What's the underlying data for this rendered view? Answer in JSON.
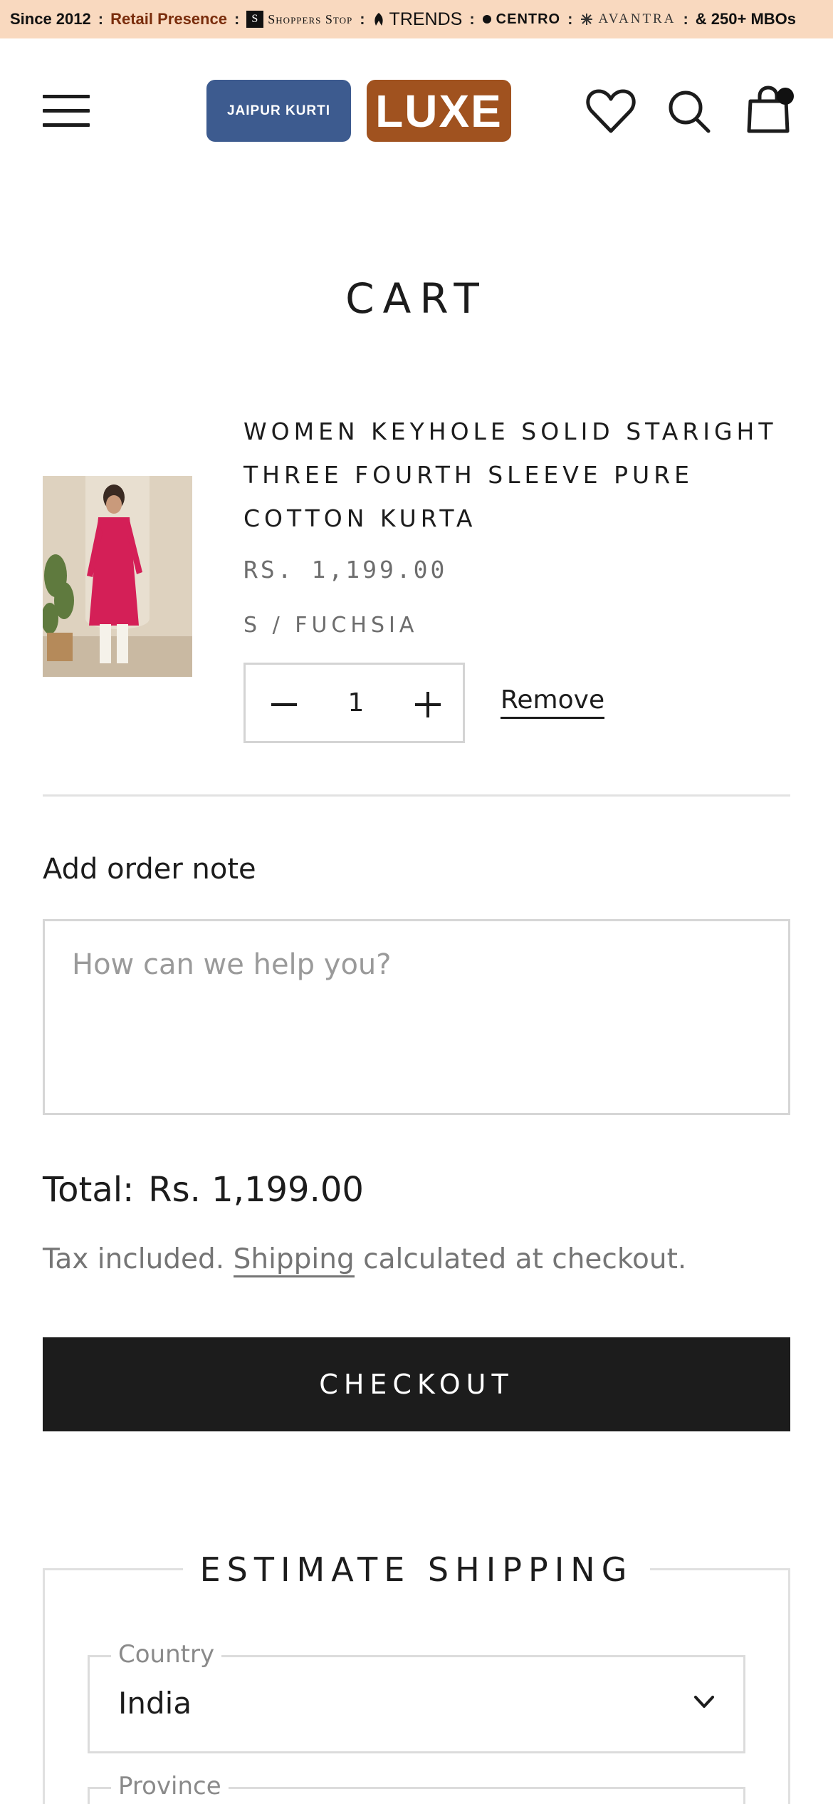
{
  "announcement": {
    "since": "Since 2012",
    "colon1": ":",
    "retail": "Retail Presence",
    "colon2": ":",
    "brand_ss_mark": "S",
    "brand_ss": "Shoppers Stop",
    "colon3": ":",
    "brand_trends": "TRENDS",
    "colon4": ":",
    "brand_centro": "CENTRO",
    "colon5": ":",
    "brand_avantra": "AVANTRA",
    "colon6": ":",
    "more": "& 250+ MBOs"
  },
  "header": {
    "logo_left": "JAIPUR KURTI",
    "logo_right": "LUXE"
  },
  "page": {
    "title": "CART"
  },
  "item": {
    "title": "WOMEN KEYHOLE SOLID STARIGHT THREE FOURTH SLEEVE PURE COTTON KURTA",
    "price": "RS. 1,199.00",
    "variant": "S / FUCHSIA",
    "quantity": "1",
    "remove_label": "Remove"
  },
  "note": {
    "label": "Add order note",
    "placeholder": "How can we help you?"
  },
  "summary": {
    "total_label": "Total:",
    "total_value": "Rs. 1,199.00",
    "tax_prefix": "Tax included.",
    "shipping_link": "Shipping",
    "tax_suffix": "calculated at checkout.",
    "checkout_label": "CHECKOUT"
  },
  "shipping": {
    "title": "ESTIMATE SHIPPING",
    "country_label": "Country",
    "country_value": "India",
    "province_label": "Province"
  },
  "colors": {
    "announce_bg": "#f9d9bf",
    "retail_text": "#7a2d0c",
    "jk_logo": "#3d5b8f",
    "luxe_logo": "#a0521f",
    "checkout_bg": "#1c1c1c"
  },
  "icons": {
    "menu": "menu-icon",
    "wishlist": "heart-icon",
    "search": "search-icon",
    "cart": "bag-icon",
    "dropdown": "chevron-down-icon"
  }
}
